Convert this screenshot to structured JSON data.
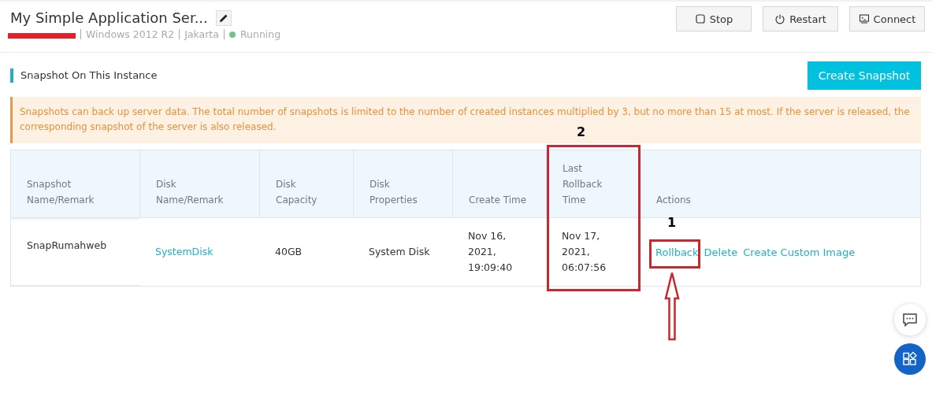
{
  "header": {
    "title": "My Simple Application Ser...",
    "details": [
      "Windows 2012 R2",
      "Jakarta"
    ],
    "status": {
      "label": "Running",
      "color": "#6cc784"
    },
    "buttons": [
      {
        "kind": "stop",
        "label": "Stop"
      },
      {
        "kind": "restart",
        "label": "Restart"
      },
      {
        "kind": "connect",
        "label": "Connect"
      }
    ]
  },
  "section": {
    "title": "Snapshot On This Instance",
    "button": "Create Snapshot"
  },
  "notice": "Snapshots can back up server data. The total number of snapshots is limited to the number of created instances multiplied by 3, but no more than 15 at most. If the server is released, the corresponding snapshot of the server is also released.",
  "table": {
    "columns": [
      "Snapshot Name/Remark",
      "Disk Name/Remark",
      "Disk Capacity",
      "Disk Properties",
      "Create Time",
      "Last Rollback Time",
      "Actions"
    ],
    "rows": [
      {
        "snapshot": "SnapRumahweb",
        "disk": "SystemDisk",
        "capacity": "40GB",
        "properties": "System Disk",
        "create_time": "Nov 16, 2021, 19:09:40",
        "rollback_time": "Nov 17, 2021, 06:07:56",
        "actions": [
          "Rollback",
          "Delete",
          "Create Custom Image"
        ]
      }
    ]
  },
  "annotations": [
    {
      "label": "1"
    },
    {
      "label": "2"
    }
  ]
}
